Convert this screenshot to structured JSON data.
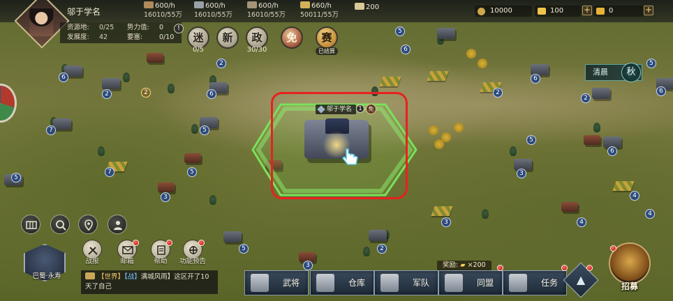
{
  "player": {
    "name": "邬于学名"
  },
  "resources": [
    {
      "icon": "wood-icon",
      "rate": "600/h",
      "amount": "16010/55万",
      "color": "#b08a5a"
    },
    {
      "icon": "iron-icon",
      "rate": "600/h",
      "amount": "16010/55万",
      "color": "#9aa0a8"
    },
    {
      "icon": "stone-icon",
      "rate": "600/h",
      "amount": "16010/55万",
      "color": "#a69478"
    },
    {
      "icon": "grain-icon",
      "rate": "660/h",
      "amount": "50011/55万",
      "color": "#d4b25a"
    },
    {
      "icon": "decree-icon",
      "rate": "200",
      "amount": "",
      "color": "#d9c998"
    }
  ],
  "currencies": [
    {
      "icon": "copper-coin-icon",
      "value": "10000",
      "color": "#d0a84a"
    },
    {
      "icon": "gold-ingot-icon",
      "value": "100",
      "color": "#f0c44a"
    },
    {
      "icon": "gold-bar-icon",
      "value": "0",
      "color": "#e8b23a"
    }
  ],
  "info": {
    "resource_land_label": "资源地:",
    "resource_land_value": "0/25",
    "power_label": "势力值:",
    "power_value": "0",
    "development_label": "发展度:",
    "development_value": "42",
    "fortress_label": "要塞:",
    "fortress_value": "0/10",
    "alert": "!"
  },
  "quick_buttons": [
    {
      "label": "迷",
      "sub": "0/5"
    },
    {
      "label": "新",
      "sub": ""
    },
    {
      "label": "政",
      "sub": "30/30"
    },
    {
      "label": "免",
      "sub": ""
    },
    {
      "label": "赛",
      "sub": "已结算"
    }
  ],
  "season": {
    "time": "清晨",
    "season": "秋"
  },
  "home_city": {
    "name": "邬于学名",
    "level": "1",
    "shield": "免"
  },
  "tools": [
    "map-icon",
    "search-icon",
    "location-pin-icon",
    "troops-icon"
  ],
  "actions": [
    {
      "label": "战报",
      "icon": "battle-report-icon",
      "badge": false
    },
    {
      "label": "邮箱",
      "icon": "mail-icon",
      "badge": true
    },
    {
      "label": "帮助",
      "icon": "help-icon",
      "badge": true
    },
    {
      "label": "功能预告",
      "icon": "preview-icon",
      "badge": true
    }
  ],
  "city_tile": {
    "label": "巴蜀·永寿"
  },
  "chat": {
    "channel": "【世界】",
    "tag": "【战】",
    "text": "满城风雨】这区开了10天了自己"
  },
  "reward": {
    "label": "奖励",
    "amount": "×200"
  },
  "menu": [
    {
      "label": "武将",
      "icon": "general-icon"
    },
    {
      "label": "仓库",
      "icon": "warehouse-icon"
    },
    {
      "label": "军队",
      "icon": "army-icon"
    },
    {
      "label": "同盟",
      "icon": "alliance-icon"
    },
    {
      "label": "任务",
      "icon": "task-icon"
    }
  ],
  "recruit": {
    "label": "招募"
  },
  "map_levels": [
    "6",
    "2",
    "2",
    "6",
    "6",
    "5",
    "2",
    "6",
    "2",
    "7",
    "5",
    "6",
    "5",
    "5",
    "7",
    "6",
    "3",
    "3",
    "4",
    "3",
    "4",
    "5",
    "2",
    "3",
    "5",
    "2",
    "5",
    "4"
  ]
}
